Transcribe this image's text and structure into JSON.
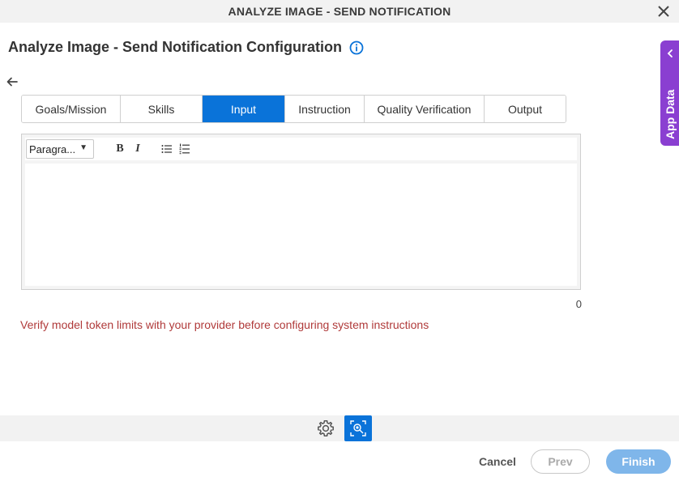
{
  "window": {
    "title": "ANALYZE IMAGE - SEND NOTIFICATION"
  },
  "page": {
    "title": "Analyze Image - Send Notification Configuration"
  },
  "tabs": [
    {
      "label": "Goals/Mission"
    },
    {
      "label": "Skills"
    },
    {
      "label": "Input",
      "active": true
    },
    {
      "label": "Instruction"
    },
    {
      "label": "Quality Verification"
    },
    {
      "label": "Output"
    }
  ],
  "editor": {
    "format_select": "Paragra...",
    "bold_label": "B",
    "italic_label": "I",
    "content": "",
    "char_count": "0"
  },
  "warning": "Verify model token limits with your provider before configuring system instructions",
  "side_panel": {
    "label": "App Data"
  },
  "footer": {
    "cancel": "Cancel",
    "prev": "Prev",
    "finish": "Finish"
  },
  "colors": {
    "accent": "#0a73d9",
    "side_panel": "#8a3fd1",
    "warning": "#b03a3a",
    "finish_disabled": "#7fb6ea"
  },
  "icons": [
    "close-icon",
    "info-icon",
    "back-arrow-icon",
    "bullet-list-icon",
    "numbered-list-icon",
    "chevron-left-icon",
    "gear-icon",
    "analyze-image-icon"
  ]
}
